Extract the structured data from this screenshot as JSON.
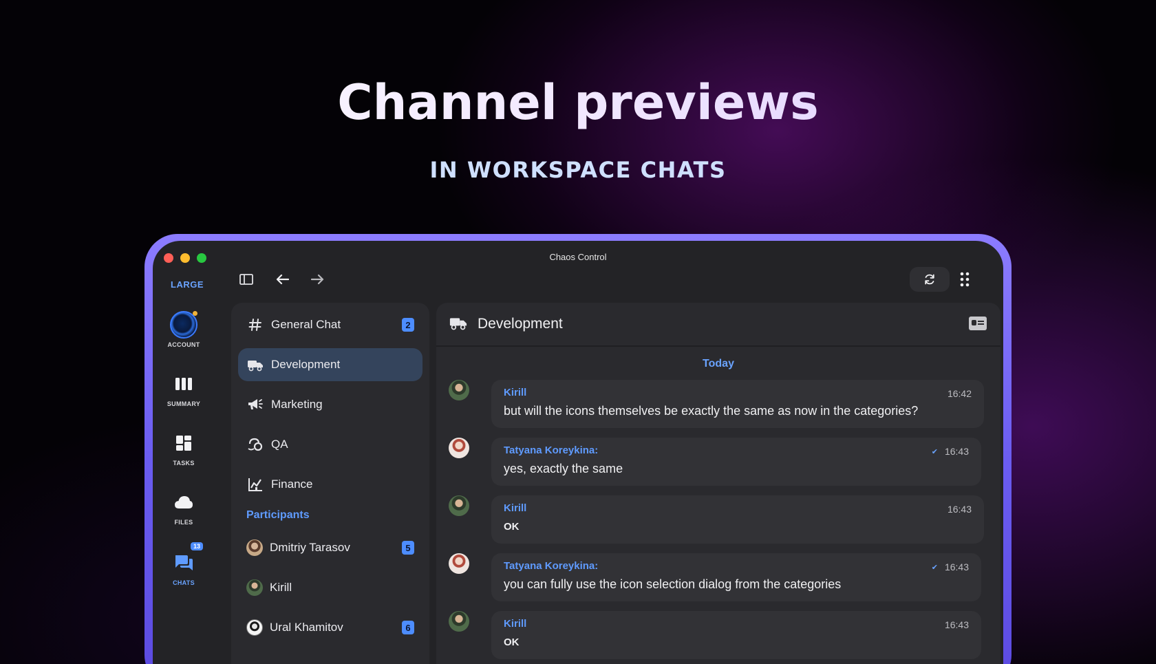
{
  "headline": "Channel previews",
  "subheadline": "IN WORKSPACE CHATS",
  "window": {
    "title": "Chaos Control"
  },
  "rail": {
    "size_label": "LARGE",
    "items": [
      {
        "label": "ACCOUNT"
      },
      {
        "label": "SUMMARY"
      },
      {
        "label": "TASKS"
      },
      {
        "label": "FILES"
      },
      {
        "label": "CHATS",
        "badge": "13"
      }
    ]
  },
  "channels": [
    {
      "name": "General Chat",
      "icon": "hash-icon",
      "badge": "2"
    },
    {
      "name": "Development",
      "icon": "truck-icon",
      "active": true
    },
    {
      "name": "Marketing",
      "icon": "megaphone-icon"
    },
    {
      "name": "QA",
      "icon": "bug-icon"
    },
    {
      "name": "Finance",
      "icon": "chart-icon"
    }
  ],
  "participants_title": "Participants",
  "participants": [
    {
      "name": "Dmitriy Tarasov",
      "badge": "5"
    },
    {
      "name": "Kirill"
    },
    {
      "name": "Ural Khamitov",
      "badge": "6"
    }
  ],
  "chat": {
    "title": "Development",
    "day": "Today",
    "messages": [
      {
        "author": "Kirill",
        "time": "16:42",
        "text": "but will the icons themselves be exactly the same as now in the categories?"
      },
      {
        "author": "Tatyana Koreykina:",
        "time": "16:43",
        "text": "yes, exactly the same",
        "read": true
      },
      {
        "author": "Kirill",
        "time": "16:43",
        "text": "OK"
      },
      {
        "author": "Tatyana Koreykina:",
        "time": "16:43",
        "text": "you can fully use the icon selection dialog from the categories",
        "read": true
      },
      {
        "author": "Kirill",
        "time": "16:43",
        "text": "OK"
      }
    ]
  },
  "colors": {
    "accent": "#5f9bff",
    "frame": "#6a5cf0",
    "active_item": "#34445c"
  }
}
